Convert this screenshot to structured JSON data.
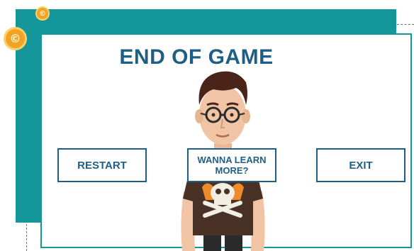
{
  "game": {
    "title": "END OF GAME",
    "buttons": {
      "restart": "RESTART",
      "learn_more": "WANNA LEARN MORE?",
      "exit": "EXIT"
    },
    "coin_symbol": "©"
  },
  "colors": {
    "frame": "#15969a",
    "text": "#1f5f86",
    "coin": "#f2a325"
  },
  "icons": [
    "coin-icon",
    "avatar-character"
  ]
}
